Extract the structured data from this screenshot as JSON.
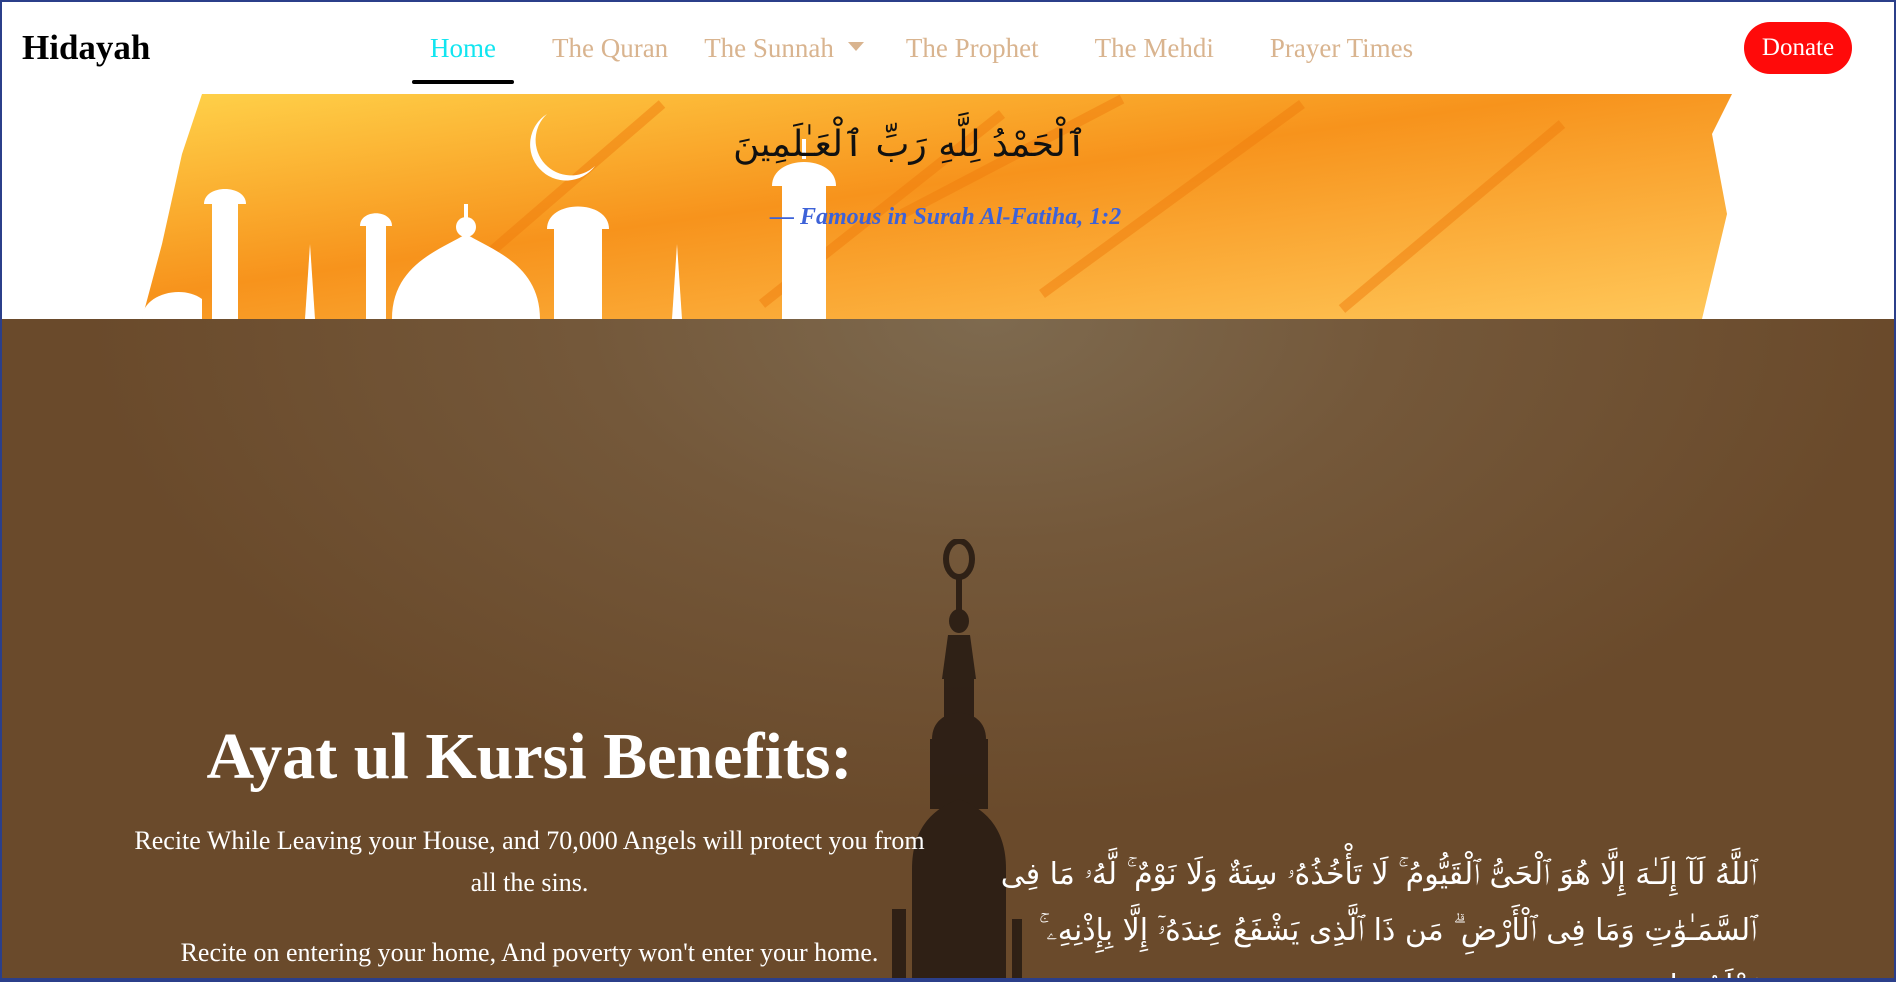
{
  "navbar": {
    "brand": "Hidayah",
    "items": [
      {
        "label": "Home",
        "active": true
      },
      {
        "label": "The Quran"
      },
      {
        "label": "The Sunnah",
        "dropdown": true
      },
      {
        "label": "The Prophet"
      },
      {
        "label": "The Mehdi"
      },
      {
        "label": "Prayer Times"
      }
    ],
    "donate_label": "Donate"
  },
  "banner": {
    "arabic": "ٱلْحَمْدُ لِلَّهِ رَبِّ ٱلْعَـٰلَمِينَ",
    "citation": "— Famous in Surah Al-Fatiha, 1:2"
  },
  "hero": {
    "title": "Ayat ul Kursi Benefits:",
    "benefits": [
      "Recite While Leaving your House, and 70,000 Angels will protect you from all the sins.",
      "Recite on entering your home, And poverty won't enter your home."
    ],
    "ayat_text": "ٱللَّهُ لَآ إِلَـٰهَ إِلَّا هُوَ ٱلْحَىُّ ٱلْقَيُّومُ ۚ لَا تَأْخُذُهُۥ سِنَةٌ وَلَا نَوْمٌ ۚ لَّهُۥ مَا فِى ٱلسَّمَـٰوَٰتِ وَمَا فِى ٱلْأَرْضِ ۗ مَن ذَا ٱلَّذِى يَشْفَعُ عِندَهُۥٓ إِلَّا بِإِذْنِهِۦ ۚ يَعْلَمُ مَا"
  },
  "colors": {
    "active_nav": "#11e5f0",
    "nav_text": "#d9b48f",
    "donate_bg": "#ff0a0a",
    "citation": "#3d62d8",
    "banner_orange": "#f59a1a",
    "hero_brown": "#74583a"
  }
}
